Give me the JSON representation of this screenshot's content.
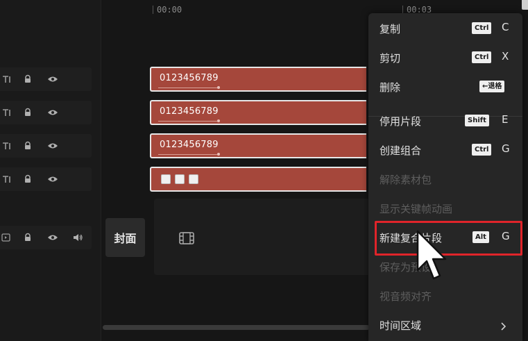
{
  "timeline": {
    "ruler_start": "00:00",
    "ruler_next": "00:03",
    "clips": [
      {
        "label": "0123456789"
      },
      {
        "label": "0123456789"
      },
      {
        "label": "0123456789"
      }
    ],
    "cover_label": "封面"
  },
  "track_icons": [
    "text-track-icon",
    "lock-icon",
    "eye-icon",
    "volume-icon",
    "film-icon"
  ],
  "context_menu": {
    "items": [
      {
        "label": "复制",
        "badge": "Ctrl",
        "key": "C"
      },
      {
        "label": "剪切",
        "badge": "Ctrl",
        "key": "X"
      },
      {
        "label": "删除",
        "badge": "←退格"
      },
      {
        "label": "停用片段",
        "badge": "Shift",
        "key": "E"
      },
      {
        "label": "创建组合",
        "badge": "Ctrl",
        "key": "G"
      },
      {
        "label": "解除素材包"
      },
      {
        "label": "显示关键帧动画"
      },
      {
        "label": "新建复合片段",
        "badge": "Alt",
        "key": "G"
      },
      {
        "label": "保存为预设"
      },
      {
        "label": "视音频对齐"
      },
      {
        "label": "时间区域"
      }
    ]
  },
  "colors": {
    "clip_fill": "#a5473b",
    "menu_bg": "#262626",
    "highlight": "#e0242a"
  }
}
